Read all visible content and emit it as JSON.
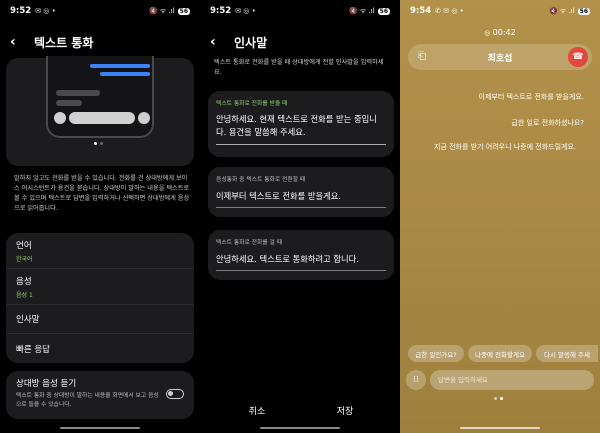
{
  "left_panel": {
    "status": {
      "time": "9:52",
      "icons": "✉ ◎ •",
      "right_icons": "🔇 ᯤ .ıl",
      "battery": "56"
    },
    "title": "텍스트 통화",
    "description": "말하지 않고도 전화를 받을 수 있습니다. 전화를 건 상대방에게 보이스 어시스턴트가 용건을 묻습니다. 상대방이 말하는 내용을 텍스트로 볼 수 있으며 텍스트로 답변을 입력하거나 선택하면 상대방에게 음성으로 읽어줍니다.",
    "menu": [
      {
        "title": "언어",
        "sub": "한국어"
      },
      {
        "title": "음성",
        "sub": "음성 1"
      },
      {
        "title": "인사말",
        "sub": ""
      },
      {
        "title": "빠른 응답",
        "sub": ""
      }
    ],
    "listen": {
      "title": "상대방 음성 듣기",
      "desc": "텍스트 통화 중 상대방이 말하는 내용을 화면에서 보고 음성으로 들을 수 있습니다.",
      "enabled": false
    }
  },
  "middle_panel": {
    "status": {
      "time": "9:52",
      "icons": "✉ ◎ •",
      "right_icons": "🔇 ᯤ .ıl",
      "battery": "56"
    },
    "title": "인사말",
    "intro": "텍스트 통화로 전화를 받을 때 상대방에게 전할 인사말을 입력하세요.",
    "fields": [
      {
        "label": "텍스트 통화로 전화를 받을 때",
        "value": "안녕하세요. 현재 텍스트로 전화를 받는 중입니다. 용건을 말씀해 주세요."
      },
      {
        "label": "음성통화 중 텍스트 통화로 전환할 때",
        "value": "이제부터 텍스트로 전화를 받을게요."
      },
      {
        "label": "텍스트 통화로 전화를 걸 때",
        "value": "안녕하세요. 텍스트로 통화하려고 합니다."
      }
    ],
    "cancel_label": "취소",
    "save_label": "저장"
  },
  "right_panel": {
    "status": {
      "time": "9:54",
      "icons": "✆ ✉ ◎ •",
      "right_icons": "🔇 ᯤ .ıl",
      "battery": "56"
    },
    "timer": "00:42",
    "caller": "최호섭",
    "messages": [
      "이제부터 텍스트로 전화를 받을게요.",
      "급한 일로 전화하셨나요?",
      "지금 전화를 받기 어려우니 나중에 전화드릴게요."
    ],
    "chips": [
      "급한 일인가요?",
      "나중에 전화할게요",
      "다시 말씀해 주세"
    ],
    "input_placeholder": "답변을 입력하세요"
  },
  "colors": {
    "accent_green": "#8fd16a",
    "end_call": "#e2483d",
    "card": "#1c1c1e",
    "gold": "#a98a44"
  }
}
